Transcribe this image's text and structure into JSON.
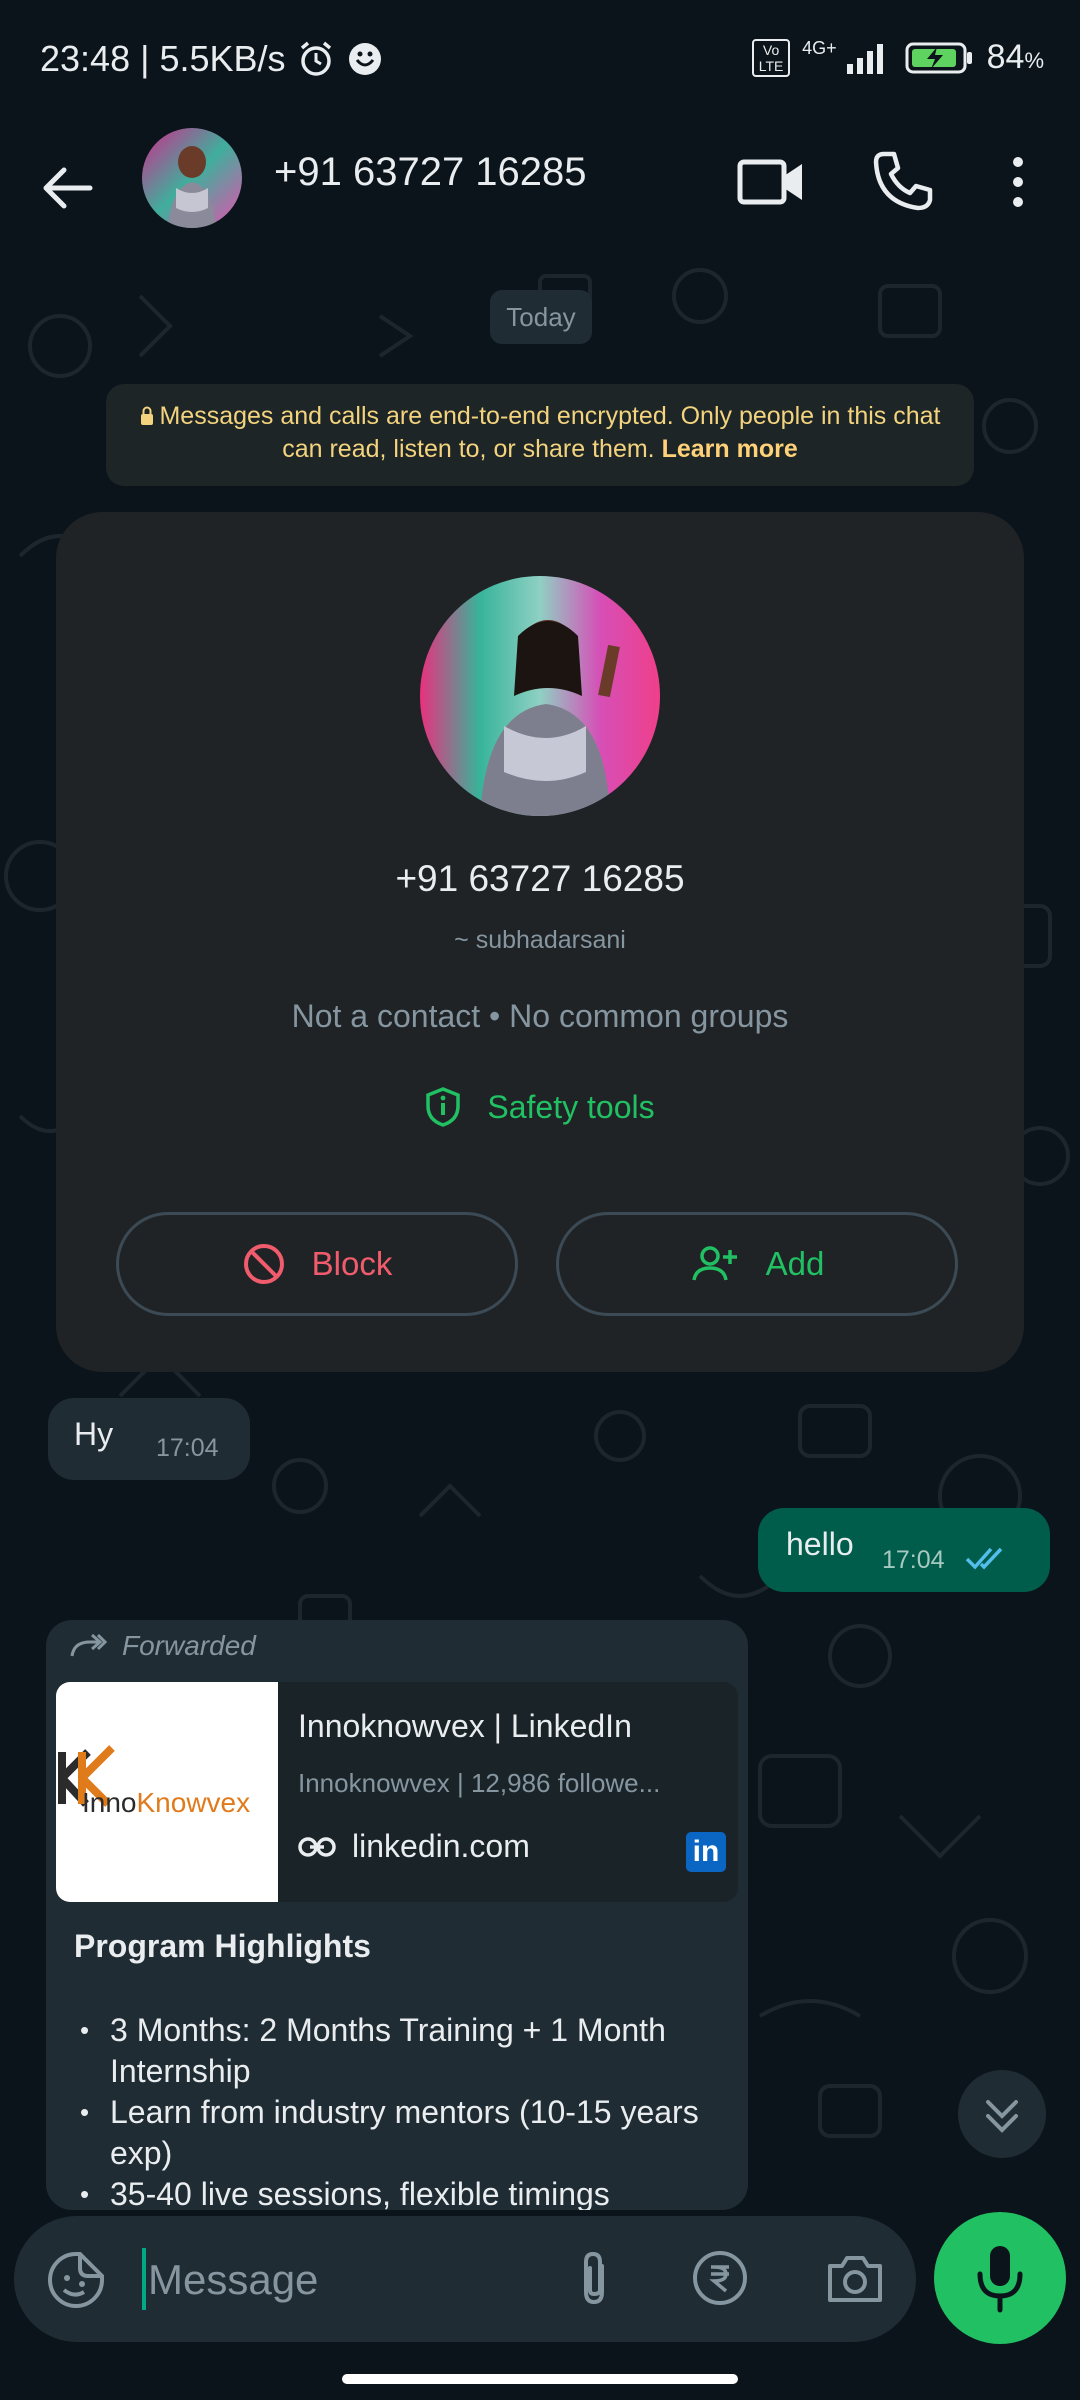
{
  "status_bar": {
    "time": "23:48",
    "speed": "5.5KB/s",
    "volte": "Vo LTE",
    "network": "4G+",
    "battery": "84",
    "battery_unit": "%"
  },
  "header": {
    "title": "+91 63727 16285"
  },
  "chat": {
    "date_chip": "Today",
    "e2e_text": "Messages and calls are end-to-end encrypted. Only people in this chat can read, listen to, or share them.",
    "e2e_link": "Learn more",
    "contact_card": {
      "phone": "+91 63727 16285",
      "name": "~ subhadarsani",
      "status": "Not a contact • No common groups",
      "safety_label": "Safety tools",
      "block_label": "Block",
      "add_label": "Add"
    },
    "messages": [
      {
        "direction": "in",
        "text": "Hy",
        "time": "17:04"
      },
      {
        "direction": "out",
        "text": "hello",
        "time": "17:04",
        "status": "read"
      }
    ],
    "forwarded": {
      "label": "Forwarded",
      "link_preview": {
        "logo_text_1": "InnoKnowvex",
        "title": "Innoknowvex | LinkedIn",
        "description": "Innoknowvex | 12,986 followe...",
        "domain": "linkedin.com",
        "badge": "in"
      },
      "body_title": "Program Highlights",
      "bullets": [
        "3 Months: 2 Months Training + 1 Month Internship",
        "Learn from industry mentors (10-15 years exp)",
        "35-40 live sessions, flexible timings"
      ]
    }
  },
  "input": {
    "placeholder": "Message"
  },
  "colors": {
    "background": "#0b141a",
    "accent_green": "#21c063",
    "outgoing_bubble": "#005c4b",
    "incoming_bubble": "#202c33",
    "danger": "#f15c6d"
  },
  "icons": [
    "alarm-icon",
    "face-icon",
    "back-arrow-icon",
    "video-call-icon",
    "voice-call-icon",
    "more-vert-icon",
    "lock-icon",
    "shield-icon",
    "block-icon",
    "add-person-icon",
    "double-tick-icon",
    "forward-icon",
    "link-icon",
    "linkedin-icon",
    "chevrons-down-icon",
    "sticker-icon",
    "attach-icon",
    "rupee-icon",
    "camera-icon",
    "mic-icon"
  ]
}
